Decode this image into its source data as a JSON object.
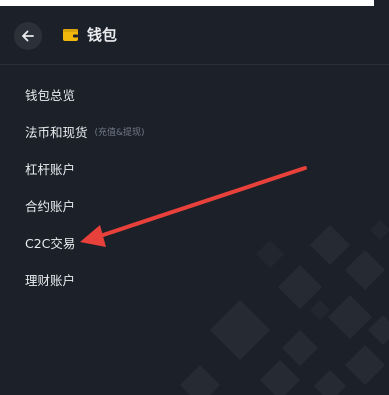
{
  "header": {
    "title": "钱包",
    "back_icon": "arrow-left-icon",
    "wallet_icon": "wallet-icon",
    "wallet_icon_color": "#f0b90b"
  },
  "menu": {
    "items": [
      {
        "label": "钱包总览",
        "sub": ""
      },
      {
        "label": "法币和现货",
        "sub": "(充值&提现)"
      },
      {
        "label": "杠杆账户",
        "sub": ""
      },
      {
        "label": "合约账户",
        "sub": ""
      },
      {
        "label": "C2C交易",
        "sub": ""
      },
      {
        "label": "理财账户",
        "sub": ""
      }
    ]
  },
  "annotation": {
    "arrow_color": "#e8403a"
  },
  "colors": {
    "background": "#1c2028",
    "text": "#eaecef",
    "muted": "#707a8a"
  }
}
